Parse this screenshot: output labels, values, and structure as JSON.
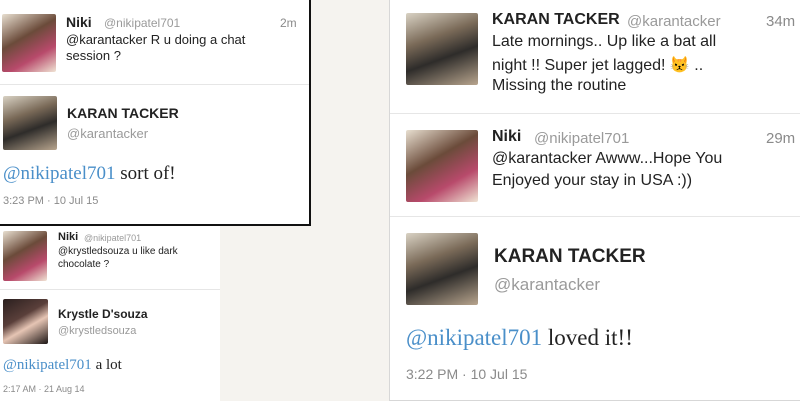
{
  "panel_a": {
    "tweet1": {
      "name": "Niki",
      "handle": "@nikipatel701",
      "time": "2m",
      "line1": "@karantacker R u doing a chat",
      "line2": "session ?"
    },
    "reply": {
      "name": "KARAN TACKER",
      "handle": "@karantacker",
      "mention": "@nikipatel701",
      "text": " sort of!",
      "timestamp": "3:23 PM · 10 Jul 15"
    }
  },
  "panel_b": {
    "tweet1": {
      "name": "Niki",
      "handle": "@nikipatel701",
      "line1": "@krystledsouza u like  dark",
      "line2": "chocolate ?"
    },
    "reply": {
      "name": "Krystle D'souza",
      "handle": "@krystledsouza",
      "mention": "@nikipatel701",
      "text": " a lot",
      "timestamp": "2:17 AM · 21 Aug 14"
    }
  },
  "panel_c": {
    "tweet1": {
      "name": "KARAN TACKER",
      "handle": "@karantacker",
      "time": "34m",
      "line1": "Late mornings.. Up like a bat all",
      "line2": "night !! Super jet lagged! 😾 ..",
      "line3": "Missing the routine"
    },
    "tweet2": {
      "name": "Niki",
      "handle": "@nikipatel701",
      "time": "29m",
      "line1": "@karantacker Awww...Hope You",
      "line2": "Enjoyed your stay in USA :))"
    },
    "reply": {
      "name": "KARAN TACKER",
      "handle": "@karantacker",
      "mention": "@nikipatel701",
      "text": " loved it!!",
      "timestamp": "3:22 PM · 10 Jul 15"
    }
  }
}
